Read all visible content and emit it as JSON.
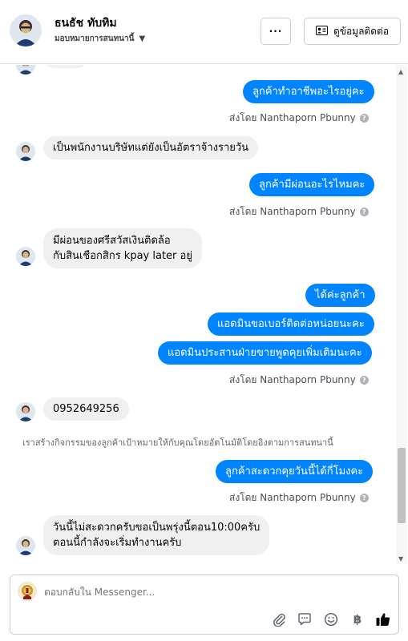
{
  "header": {
    "name": "ธนธัช ทับทิม",
    "assign_label": "มอบหมายการสนทนานี้",
    "more_label": "···",
    "contact_button_label": "ดูข้อมูลติดต่อ"
  },
  "conversation": {
    "messages": [
      {
        "text": "ลูกค้าทำอาชีพอะไรอยู่คะ"
      },
      {
        "sent_by": "ส่งโดย Nanthaporn Pbunny"
      },
      {
        "text": "เป็นพนักงานบริษัทแต่ยังเป็นอัตราจ้างรายวัน"
      },
      {
        "text": "ลูกค้ามีผ่อนอะไรไหมคะ"
      },
      {
        "sent_by": "ส่งโดย Nanthaporn Pbunny"
      },
      {
        "text_line1": "มีผ่อนของศรีสวัสเงินติดล้อ",
        "text_line2": "กับสินเชือกสิกร kpay later อยู่"
      },
      {
        "text": "ได้ค่ะลูกค้า"
      },
      {
        "text": "แอดมินขอเบอร์ติดต่อหน่อยนะคะ"
      },
      {
        "text": "แอดมินประสานฝ่ายขายพูดคุยเพิ่มเติมนะคะ"
      },
      {
        "sent_by": "ส่งโดย Nanthaporn Pbunny"
      },
      {
        "text": "0952649256"
      },
      {
        "system_note": "เราสร้างกิจกรรมของลูกค้าเป้าหมายให้กับคุณโดยอัตโนมัติโดยอิงตามการสนทนานี้"
      },
      {
        "text": "ลูกค้าสะดวกคุยวันนี้ได้กี่โมงคะ"
      },
      {
        "sent_by": "ส่งโดย Nanthaporn Pbunny"
      },
      {
        "text_line1": "วันนี้ไม่สะดวกครับขอเป็นพรุ่งนี้ตอน10:00ครับ",
        "text_line2": "ตอนนี้กำลังจะเริ่มทำงานครับ"
      }
    ]
  },
  "composer": {
    "placeholder": "ตอบกลับใน Messenger..."
  },
  "icons": {
    "attach": "paperclip-icon",
    "saved_replies": "chat-bubble-icon",
    "emoji": "smiley-icon",
    "payment": "baht-icon",
    "like": "thumbs-up-icon"
  },
  "colors": {
    "outgoing_bubble": "#0084ff",
    "incoming_bubble": "#f0f0f0",
    "like_icon": "#050505"
  }
}
